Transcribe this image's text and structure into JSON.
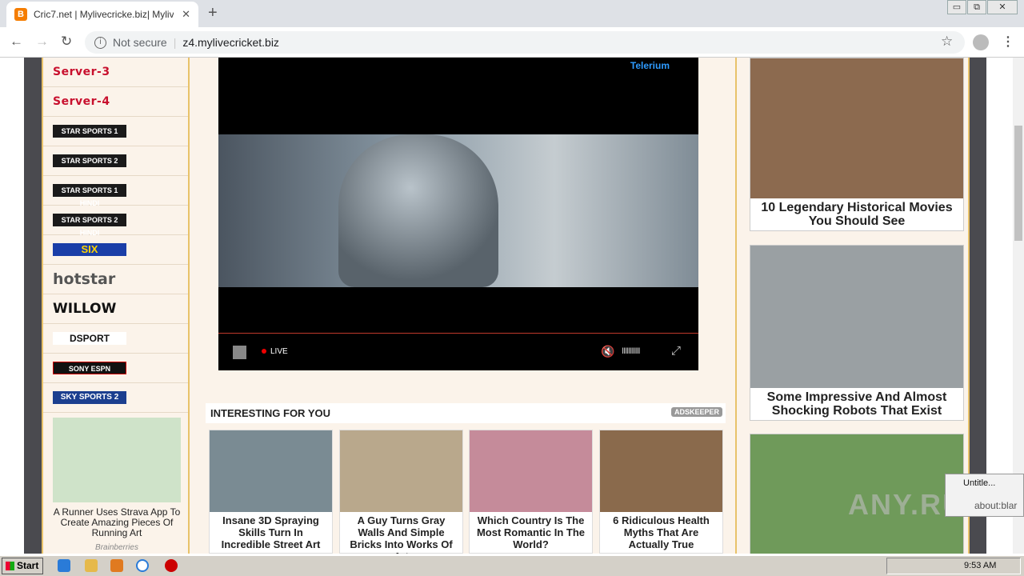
{
  "browser": {
    "tab_title": "Cric7.net | Mylivecricke.biz| Mylivecr",
    "tab_favicon": "B",
    "close_tab": "✕",
    "new_tab": "+",
    "not_secure": "Not secure",
    "url": "z4.mylivecricket.biz",
    "window_controls": [
      "▭",
      "⧉",
      "✕"
    ]
  },
  "sidebar": {
    "servers": [
      "Server-3",
      "Server-4"
    ],
    "channels": [
      "STAR SPORTS 1",
      "STAR SPORTS 2",
      "STAR SPORTS 1 HINDI",
      "STAR SPORTS 2 HINDI",
      "SIX",
      "hotstar",
      "WILLOW",
      "DSPORT",
      "SONY ESPN",
      "SKY SPORTS 2"
    ],
    "ad": {
      "caption": "A Runner Uses Strava App To Create Amazing Pieces Of Running Art",
      "brand": "Brainberries"
    }
  },
  "player": {
    "brand": "Telerium",
    "live_label": "LIVE",
    "volume": "IIIIIIIIIII"
  },
  "interesting": {
    "heading": "INTERESTING FOR YOU",
    "adskeeper": "ADSKEEPER",
    "cards": [
      {
        "caption": "Insane 3D Spraying Skills Turn In Incredible Street Art",
        "color": "#7a8b93"
      },
      {
        "caption": "A Guy Turns Gray Walls And Simple Bricks Into Works Of Art",
        "color": "#b9a88c"
      },
      {
        "caption": "Which Country Is The Most Romantic In The World?",
        "color": "#c58b9a"
      },
      {
        "caption": "6 Ridiculous Health Myths That Are Actually True",
        "color": "#8a6a4c"
      }
    ]
  },
  "right_ads": [
    {
      "caption": "10 Legendary Historical Movies You Should See",
      "color": "#8c6a4f"
    },
    {
      "caption": "Some Impressive And Almost Shocking Robots That Exist",
      "color": "#9aa0a3"
    },
    {
      "caption": "",
      "color": "#6f9a5a"
    }
  ],
  "popup": {
    "title": "Untitle...",
    "url": "about:blar"
  },
  "watermark": "ANY.RUN",
  "taskbar": {
    "start": "Start",
    "clock": "9:53 AM"
  }
}
